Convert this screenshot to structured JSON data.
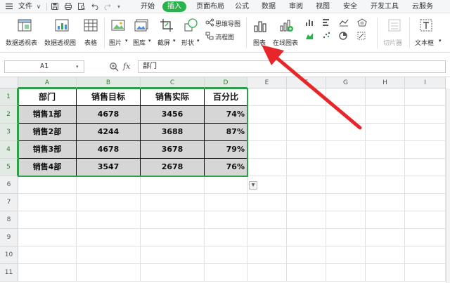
{
  "menubar": {
    "file_label": "文件",
    "items": [
      "开始",
      "插入",
      "页面布局",
      "公式",
      "数据",
      "审阅",
      "视图",
      "安全",
      "开发工具",
      "云服务"
    ],
    "active": "插入"
  },
  "ribbon": {
    "pivot_table": "数据透视表",
    "pivot_chart": "数据透视图",
    "table": "表格",
    "picture": "图片",
    "library": "图库",
    "screenshot": "截屏",
    "shapes": "形状",
    "mindmap": "思维导图",
    "flowchart": "流程图",
    "chart": "图表",
    "online_chart": "在线图表",
    "slicer": "切片器",
    "textbox": "文本框"
  },
  "formula_bar": {
    "cell_ref": "A1",
    "fx": "fx",
    "content": "部门"
  },
  "grid": {
    "columns": [
      "A",
      "B",
      "C",
      "D",
      "E",
      "F",
      "G",
      "H",
      "I"
    ],
    "rows": [
      "1",
      "2",
      "3",
      "4",
      "5",
      "6",
      "7",
      "8",
      "9",
      "10",
      "11"
    ],
    "table": {
      "headers": [
        "部门",
        "销售目标",
        "销售实际",
        "百分比"
      ],
      "rows": [
        [
          "销售1部",
          "4678",
          "3456",
          "74%"
        ],
        [
          "销售2部",
          "4244",
          "3688",
          "87%"
        ],
        [
          "销售3部",
          "4678",
          "3678",
          "79%"
        ],
        [
          "销售4部",
          "3547",
          "2678",
          "76%"
        ]
      ]
    }
  },
  "colors": {
    "accent": "#2bb24c",
    "selection": "#2e9e4a",
    "cell_shade": "#d6d6d6",
    "annotation_arrow": "#e8262a"
  }
}
